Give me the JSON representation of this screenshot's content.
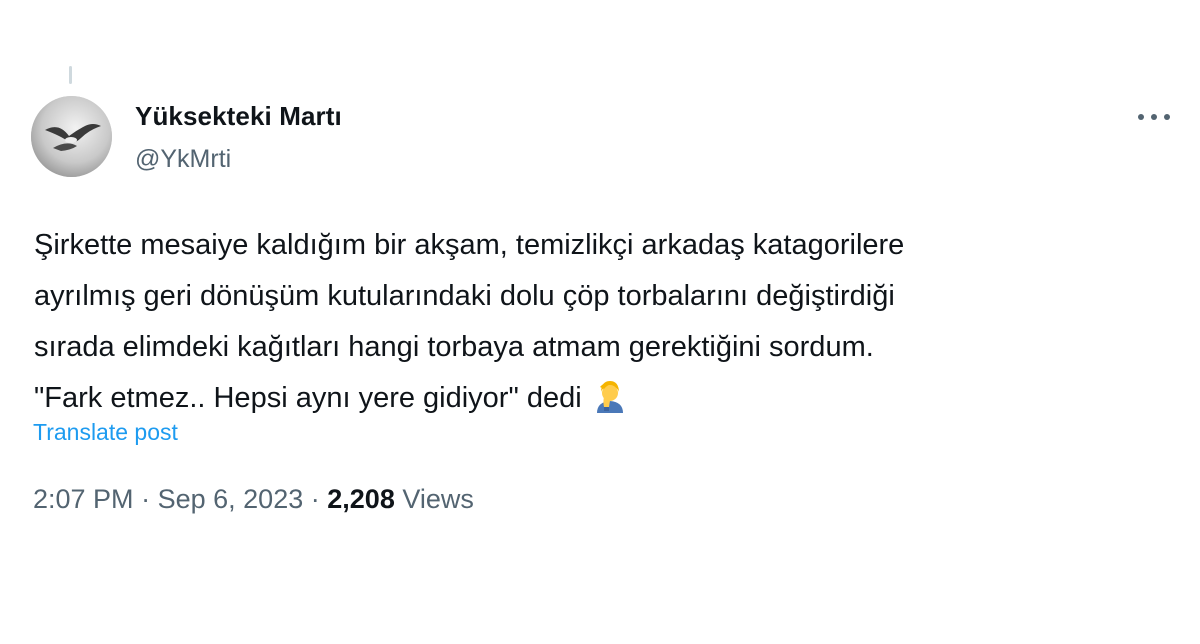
{
  "author": {
    "display_name": "Yüksekteki Martı",
    "handle": "@YkMrti",
    "avatar_icon": "seagull-avatar"
  },
  "post": {
    "lines": [
      "Şirkette mesaiye kaldığım bir akşam, temizlikçi arkadaş katagorilere",
      "ayrılmış geri dönüşüm kutularındaki dolu çöp torbalarını değiştirdiği",
      "sırada elimdeki kağıtları hangi torbaya atmam gerektiğini sordum.",
      "\"Fark etmez.. Hepsi aynı yere gidiyor\" dedi"
    ],
    "emoji": "woman-facepalming-icon",
    "translate_label": "Translate post"
  },
  "meta": {
    "time": "2:07 PM",
    "separator": "·",
    "date": "Sep 6, 2023",
    "views_count": "2,208",
    "views_label": "Views"
  },
  "actions": {
    "more_icon": "more-dots-icon"
  },
  "colors": {
    "primary_text": "#0f1419",
    "secondary_text": "#536471",
    "link": "#1d9bf0",
    "thread_line": "#cfd9de"
  }
}
